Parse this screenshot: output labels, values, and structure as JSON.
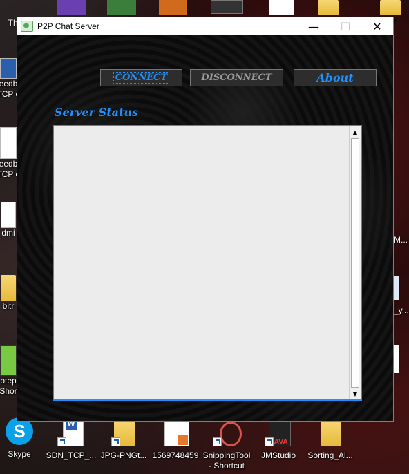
{
  "desktop": {
    "icons_top": [
      "Thi",
      "",
      "",
      "",
      "",
      "",
      "",
      "oh"
    ],
    "icons_left": [
      {
        "label1": "eedb",
        "label2": "TCP c"
      },
      {
        "label1": "eedb",
        "label2": "TCP c"
      },
      {
        "label1": "dmi",
        "label2": ""
      },
      {
        "label1": "bitr",
        "label2": ""
      },
      {
        "label1": "otep",
        "label2": "Shor"
      }
    ],
    "icons_right": [
      "M...",
      "_y...",
      ""
    ],
    "icons_bottom": [
      {
        "label1": "Skype",
        "label2": ""
      },
      {
        "label1": "SDN_TCP_...",
        "label2": ""
      },
      {
        "label1": "JPG-PNGt...",
        "label2": ""
      },
      {
        "label1": "1569748459",
        "label2": ""
      },
      {
        "label1": "SnippingTool",
        "label2": "- Shortcut"
      },
      {
        "label1": "JMStudio",
        "label2": ""
      },
      {
        "label1": "Sorting_Al...",
        "label2": ""
      }
    ]
  },
  "window": {
    "title": "P2P Chat Server",
    "minimize_glyph": "—",
    "maximize_glyph": "☐",
    "close_glyph": "✕"
  },
  "toolbar": {
    "connect_label": "CONNECT",
    "disconnect_label": "DISCONNECT",
    "about_label": "About"
  },
  "status": {
    "label": "Server Status",
    "content": ""
  },
  "scrollbar": {
    "up_glyph": "▲",
    "down_glyph": "▼"
  },
  "colors": {
    "accent": "#1e90ff",
    "window_border": "#3f8ed8",
    "panel_bg": "#ececec"
  }
}
